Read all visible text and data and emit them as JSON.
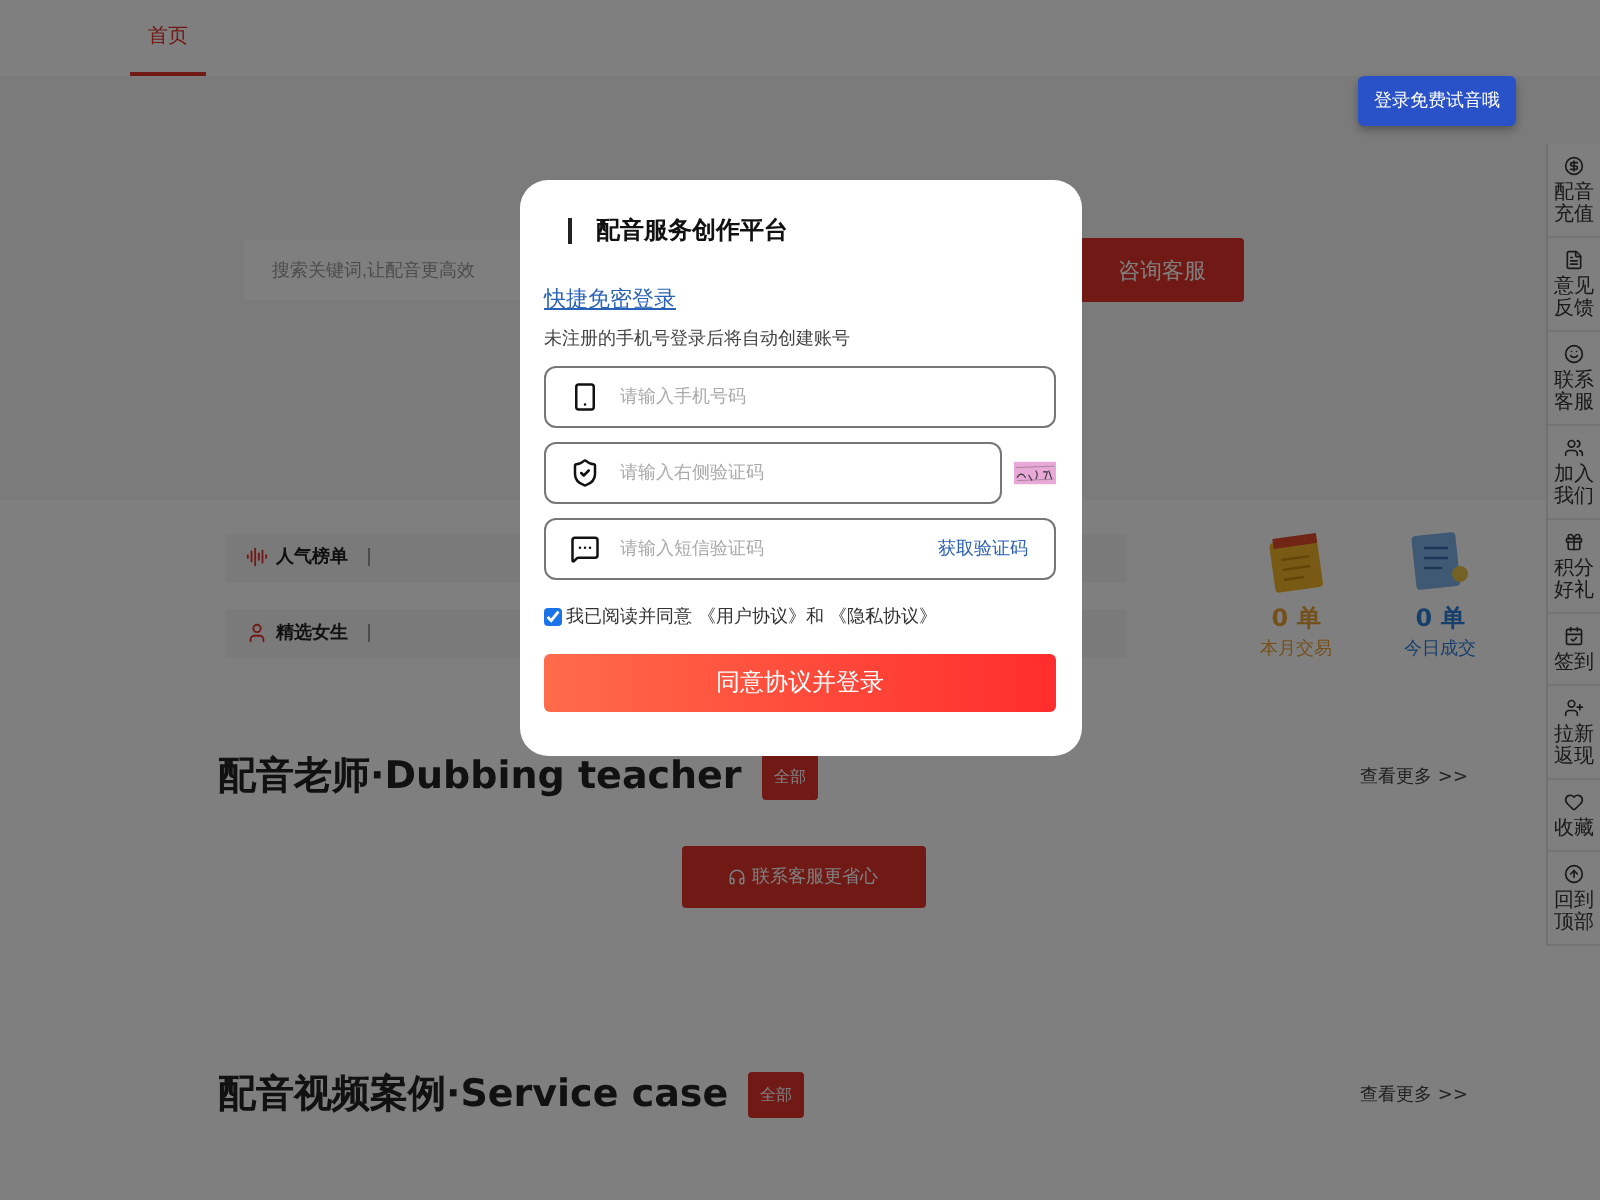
{
  "nav": {
    "items": [
      {
        "label": "首页",
        "selected": true
      }
    ]
  },
  "tooltip": "登录免费试音哦",
  "search": {
    "placeholder": "搜索关键词,让配音更高效",
    "button": "咨询客服"
  },
  "rankings": [
    {
      "kind": "chart",
      "label": "人气榜单"
    },
    {
      "kind": "female",
      "label": "精选女生"
    }
  ],
  "stats": [
    {
      "kind": "calendar",
      "value": "0 单",
      "label": "本月交易"
    },
    {
      "kind": "list",
      "value": "0 单",
      "label": "今日成交"
    }
  ],
  "sections": [
    {
      "title": "配音老师·Dubbing teacher",
      "badge": "全部",
      "more": "查看更多 >>",
      "cta": "联系客服更省心"
    },
    {
      "title": "配音视频案例·Service case",
      "badge": "全部",
      "more": "查看更多 >>"
    }
  ],
  "sidebar": [
    {
      "kind": "recharge",
      "label": "配音充值"
    },
    {
      "kind": "feedback",
      "label": "意见反馈"
    },
    {
      "kind": "service",
      "label": "联系客服"
    },
    {
      "kind": "join",
      "label": "加入我们"
    },
    {
      "kind": "points",
      "label": "积分好礼"
    },
    {
      "kind": "checkin",
      "label": "签到"
    },
    {
      "kind": "invite",
      "label": "拉新返现"
    },
    {
      "kind": "favorite",
      "label": "收藏"
    },
    {
      "kind": "top",
      "label": "回到顶部"
    }
  ],
  "modal": {
    "title": "配音服务创作平台",
    "link": "快捷免密登录",
    "hint": "未注册的手机号登录后将自动创建账号",
    "fields": [
      {
        "kind": "phone",
        "placeholder": "请输入手机号码"
      },
      {
        "kind": "captcha",
        "placeholder": "请输入右侧验证码"
      },
      {
        "kind": "sms",
        "placeholder": "请输入短信验证码",
        "action": "获取验证码"
      }
    ],
    "agreement": {
      "checked": true,
      "text": "我已阅读并同意 《用户协议》和 《隐私协议》"
    },
    "submit": "同意协议并登录"
  }
}
